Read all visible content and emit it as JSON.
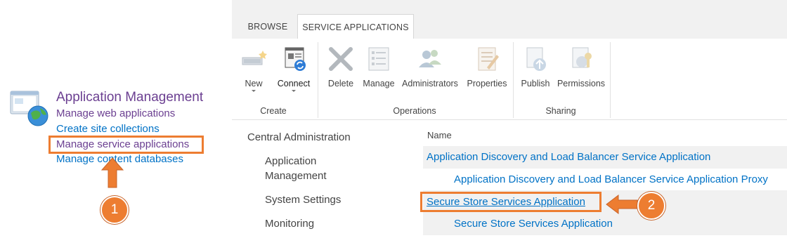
{
  "left_panel": {
    "title": "Application Management",
    "links": [
      "Manage web applications",
      "Create site collections",
      "Manage service applications",
      "Manage content databases"
    ],
    "badge_1": "1"
  },
  "ribbon": {
    "tabs": [
      "BROWSE",
      "SERVICE APPLICATIONS"
    ],
    "active_tab": "SERVICE APPLICATIONS",
    "groups": [
      {
        "label": "Create",
        "buttons": [
          {
            "label": "New",
            "icon": "new-service-icon"
          },
          {
            "label": "Connect",
            "icon": "connect-icon"
          }
        ]
      },
      {
        "label": "Operations",
        "buttons": [
          {
            "label": "Delete",
            "icon": "delete-icon"
          },
          {
            "label": "Manage",
            "icon": "manage-icon"
          },
          {
            "label": "Administrators",
            "icon": "administrators-icon"
          },
          {
            "label": "Properties",
            "icon": "properties-icon"
          }
        ]
      },
      {
        "label": "Sharing",
        "buttons": [
          {
            "label": "Publish",
            "icon": "publish-icon"
          },
          {
            "label": "Permissions",
            "icon": "permissions-icon"
          }
        ]
      }
    ]
  },
  "quick_launch": {
    "items": [
      "Central Administration",
      "Application",
      "Management",
      "System Settings",
      "Monitoring"
    ]
  },
  "list": {
    "column_header": "Name",
    "rows": [
      "Application Discovery and Load Balancer Service Application",
      "Application Discovery and Load Balancer Service Application Proxy",
      "Secure Store Services Application",
      "Secure Store Services Application"
    ],
    "badge_2": "2"
  },
  "colors": {
    "callout": "#ed7d31",
    "link": "#0072c6",
    "visited": "#6b3f91"
  }
}
